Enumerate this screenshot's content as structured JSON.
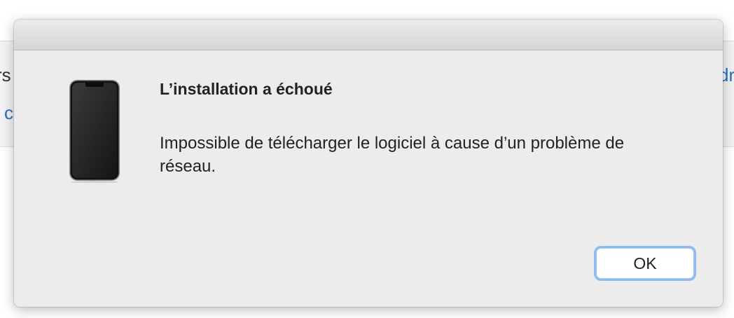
{
  "background": {
    "left_fragment": "rs",
    "left_link_fragment": "c",
    "right_link_fragment": "dr"
  },
  "dialog": {
    "icon": "iphone-device-icon",
    "title": "L’installation a échoué",
    "message": "Impossible de télécharger le logiciel à cause d’un problème de réseau.",
    "ok_label": "OK",
    "accent_color": "#8fbcef"
  }
}
